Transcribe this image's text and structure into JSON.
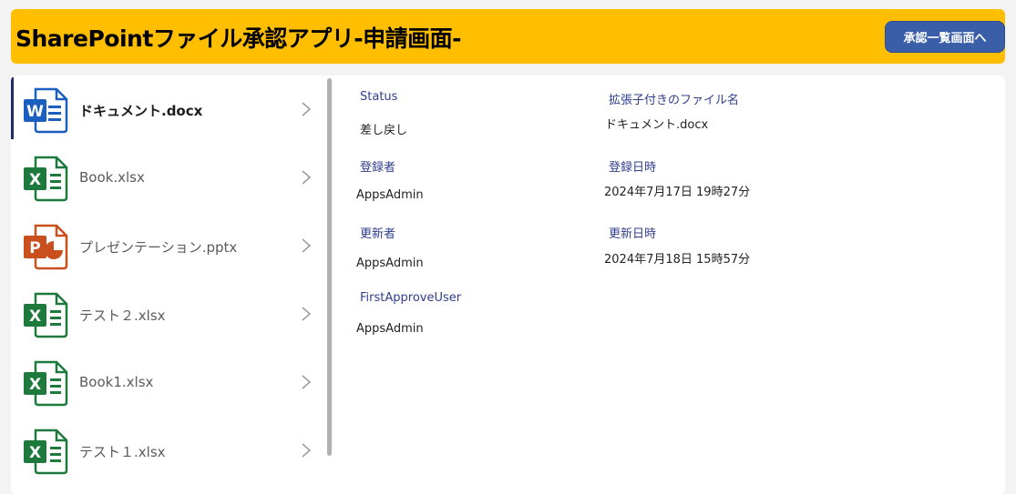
{
  "header": {
    "title": "SharePointファイル承認アプリ-申請画面-",
    "nav_button": "承認一覧画面へ",
    "bg_color": "#ffbf00",
    "button_color": "#3b5ea8"
  },
  "files": [
    {
      "name": "ドキュメント.docx",
      "icon": "word-icon",
      "selected": true
    },
    {
      "name": "Book.xlsx",
      "icon": "excel-icon",
      "selected": false
    },
    {
      "name": "プレゼンテーション.pptx",
      "icon": "powerpoint-icon",
      "selected": false
    },
    {
      "name": "テスト２.xlsx",
      "icon": "excel-icon",
      "selected": false
    },
    {
      "name": "Book1.xlsx",
      "icon": "excel-icon",
      "selected": false
    },
    {
      "name": "テスト１.xlsx",
      "icon": "excel-icon",
      "selected": false
    }
  ],
  "details": {
    "status_label": "Status",
    "status_value": "差し戻し",
    "filename_label": "拡張子付きのファイル名",
    "filename_value": "ドキュメント.docx",
    "registrant_label": "登録者",
    "registrant_value": "AppsAdmin",
    "registered_at_label": "登録日時",
    "registered_at_value": "2024年7月17日 19時27分",
    "updater_label": "更新者",
    "updater_value": "AppsAdmin",
    "updated_at_label": "更新日時",
    "updated_at_value": "2024年7月18日 15時57分",
    "first_approver_label": "FirstApproveUser",
    "first_approver_value": "AppsAdmin"
  }
}
